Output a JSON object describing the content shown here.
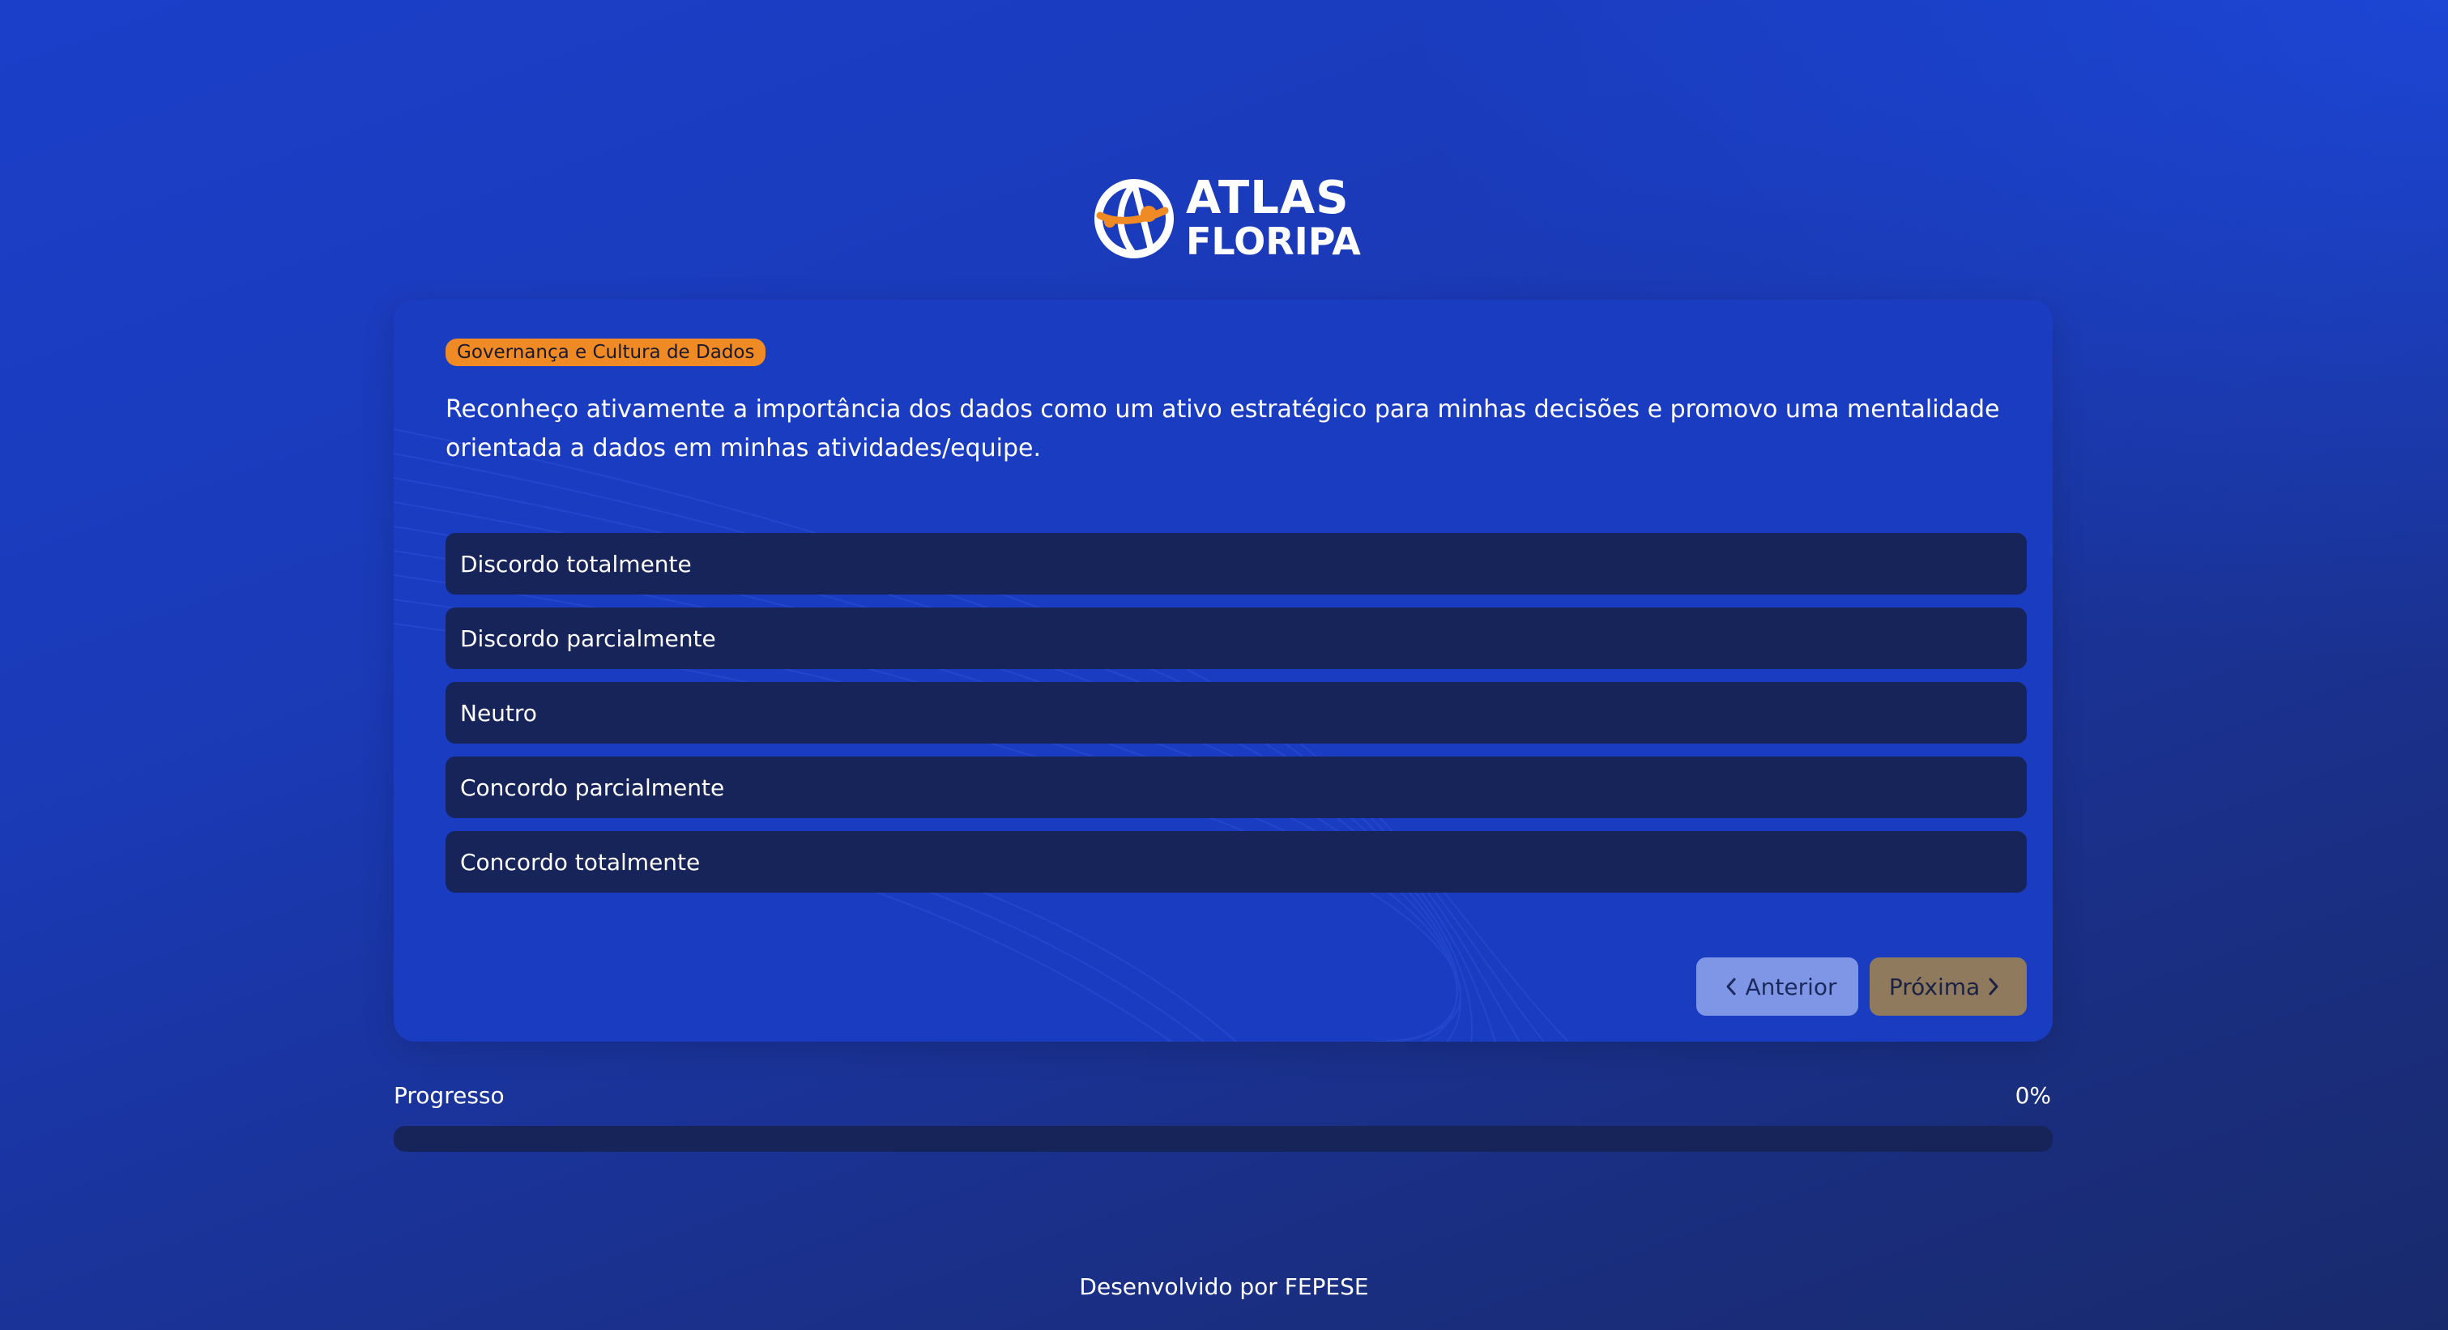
{
  "brand": {
    "line1": "ATLAS",
    "line2": "FLORIPA",
    "colors": {
      "accent": "#f08a24",
      "primary": "#1a3cc0",
      "option_bg": "#17245a"
    }
  },
  "question": {
    "category": "Governança e Cultura de Dados",
    "text": "Reconheço ativamente a importância dos dados como um ativo estratégico para minhas decisões e promovo uma mentalidade orientada a dados em minhas atividades/equipe.",
    "options": [
      "Discordo totalmente",
      "Discordo parcialmente",
      "Neutro",
      "Concordo parcialmente",
      "Concordo totalmente"
    ]
  },
  "nav": {
    "prev_label": "Anterior",
    "next_label": "Próxima",
    "prev_icon": "chevron-left-icon",
    "next_icon": "chevron-right-icon"
  },
  "progress": {
    "label": "Progresso",
    "percent_text": "0%",
    "value": 0
  },
  "footer": {
    "text": "Desenvolvido por FEPESE"
  }
}
